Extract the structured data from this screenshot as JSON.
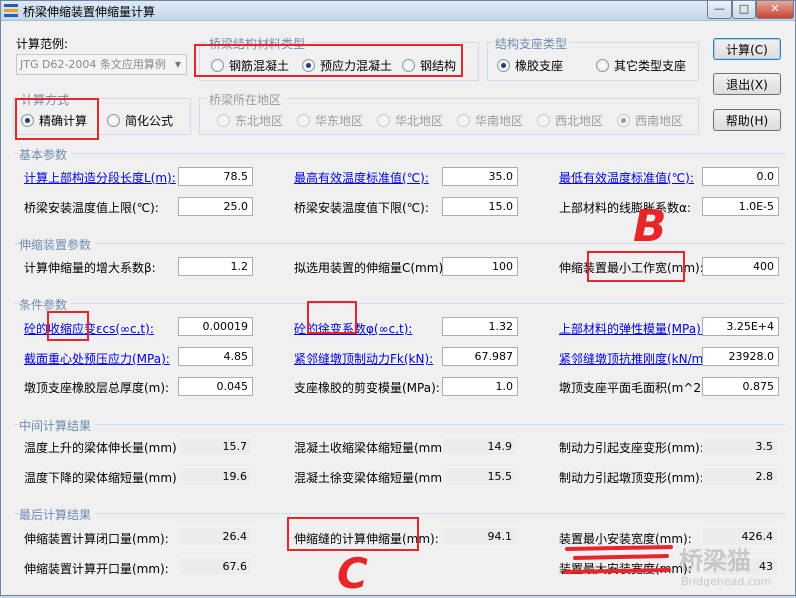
{
  "window": {
    "title": "桥梁伸缩装置伸缩量计算",
    "minimize": "—",
    "maximize": "□",
    "close": "✕"
  },
  "scope": {
    "label": "计算范例:",
    "value": "JTG D62-2004 条文应用算例"
  },
  "material": {
    "title": "桥梁结构材料类型",
    "options": [
      {
        "label": "钢筋混凝土",
        "selected": false
      },
      {
        "label": "预应力混凝土",
        "selected": true
      },
      {
        "label": "钢结构",
        "selected": false
      }
    ]
  },
  "bearing": {
    "title": "结构支座类型",
    "options": [
      {
        "label": "橡胶支座",
        "selected": true
      },
      {
        "label": "其它类型支座",
        "selected": false
      }
    ]
  },
  "method": {
    "title": "计算方式",
    "options": [
      {
        "label": "精确计算",
        "selected": true
      },
      {
        "label": "简化公式",
        "selected": false
      }
    ]
  },
  "region": {
    "title": "桥梁所在地区",
    "options": [
      {
        "label": "东北地区",
        "selected": false
      },
      {
        "label": "华东地区",
        "selected": false
      },
      {
        "label": "华北地区",
        "selected": false
      },
      {
        "label": "华南地区",
        "selected": false
      },
      {
        "label": "西北地区",
        "selected": false
      },
      {
        "label": "西南地区",
        "selected": true
      }
    ]
  },
  "buttons": {
    "calc": "计算(C)",
    "exit": "退出(X)",
    "help": "帮助(H)"
  },
  "basic": {
    "title": "基本参数",
    "fields": [
      {
        "label": "计算上部构造分段长度L(m):",
        "value": "78.5"
      },
      {
        "label": "最高有效温度标准值(℃):",
        "value": "35.0"
      },
      {
        "label": "最低有效温度标准值(℃):",
        "value": "0.0"
      },
      {
        "label": "桥梁安装温度值上限(℃):",
        "value": "25.0"
      },
      {
        "label": "桥梁安装温度值下限(℃):",
        "value": "15.0"
      },
      {
        "label": "上部材料的线膨胀系数α:",
        "value": "1.0E-5"
      }
    ]
  },
  "device": {
    "title": "伸缩装置参数",
    "fields": [
      {
        "label": "计算伸缩量的增大系数β:",
        "value": "1.2"
      },
      {
        "label": "拟选用装置的伸缩量C(mm):",
        "value": "100"
      },
      {
        "label": "伸缩装置最小工作宽(mm):",
        "value": "400"
      }
    ]
  },
  "condition": {
    "title": "条件参数",
    "fields": [
      {
        "label": "砼的收缩应变εcs(∞c,t):",
        "value": "0.00019"
      },
      {
        "label": "砼的徐变系数φ(∞c,t):",
        "value": "1.32"
      },
      {
        "label": "上部材料的弹性模量(MPa):",
        "value": "3.25E+4"
      },
      {
        "label": "截面重心处预压应力(MPa):",
        "value": "4.85"
      },
      {
        "label": "紧邻缝墩顶制动力Fk(kN):",
        "value": "67.987"
      },
      {
        "label": "紧邻缝墩顶抗推刚度(kN/m):",
        "value": "23928.0"
      },
      {
        "label": "墩顶支座橡胶层总厚度(m):",
        "value": "0.045"
      },
      {
        "label": "支座橡胶的剪变模量(MPa):",
        "value": "1.0"
      },
      {
        "label": "墩顶支座平面毛面积(m^2):",
        "value": "0.875"
      }
    ]
  },
  "middle": {
    "title": "中间计算结果",
    "fields": [
      {
        "label": "温度上升的梁体伸长量(mm):",
        "value": "15.7"
      },
      {
        "label": "混凝土收缩梁体缩短量(mm):",
        "value": "14.9"
      },
      {
        "label": "制动力引起支座变形(mm):",
        "value": "3.5"
      },
      {
        "label": "温度下降的梁体缩短量(mm):",
        "value": "19.6"
      },
      {
        "label": "混凝土徐变梁体缩短量(mm):",
        "value": "15.5"
      },
      {
        "label": "制动力引起墩顶变形(mm):",
        "value": "2.8"
      }
    ]
  },
  "final": {
    "title": "最后计算结果",
    "fields": [
      {
        "label": "伸缩装置计算闭口量(mm):",
        "value": "26.4"
      },
      {
        "label": "伸缩缝的计算伸缩量(mm):",
        "value": "94.1"
      },
      {
        "label": "装置最小安装宽度(mm):",
        "value": "426.4"
      },
      {
        "label": "伸缩装置计算开口量(mm):",
        "value": "67.6"
      },
      {
        "label": "装置最大安装宽度(mm):",
        "value": "43"
      }
    ]
  },
  "annotations": {
    "b": "B",
    "c": "C"
  },
  "watermark": {
    "cn": "桥梁猫",
    "en": "Bridgehead.com"
  }
}
